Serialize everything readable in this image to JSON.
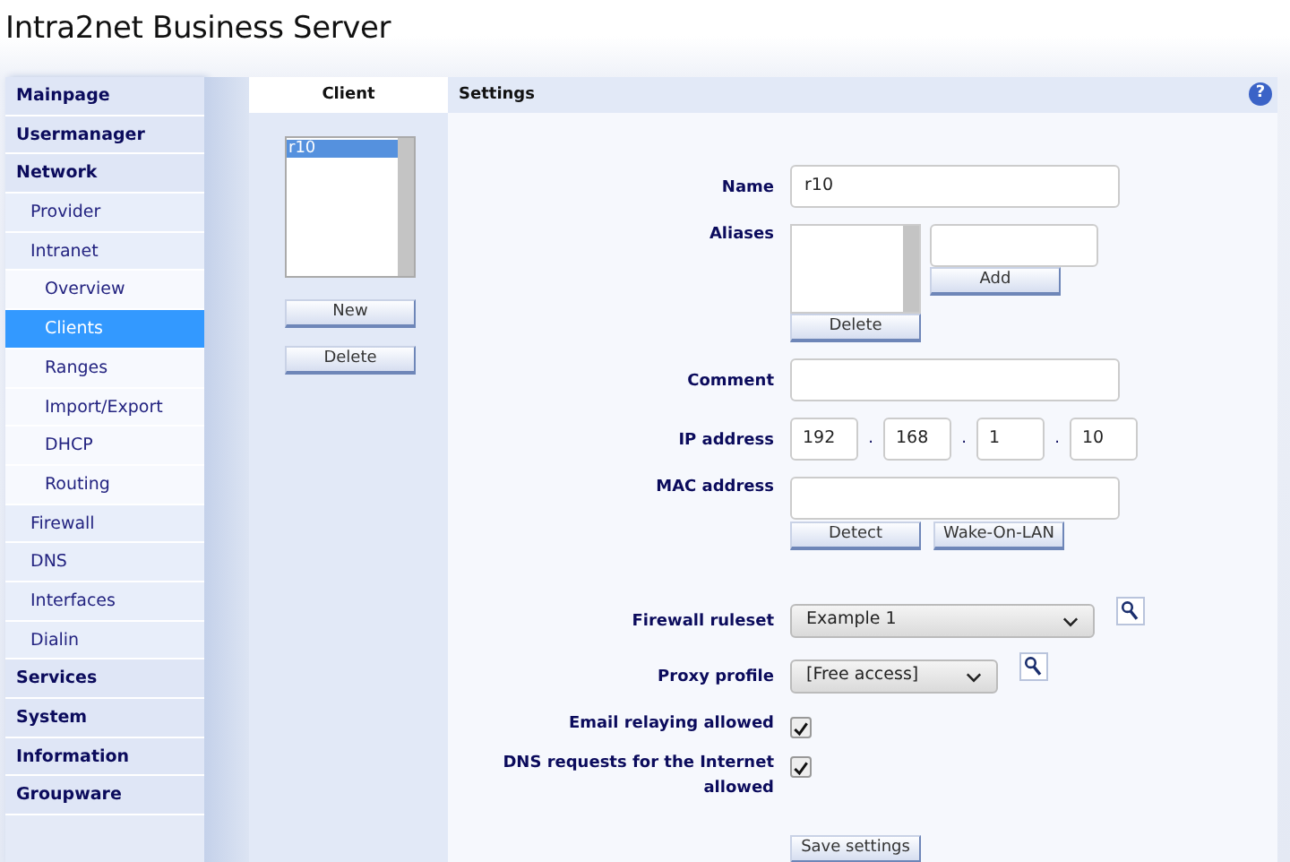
{
  "header": {
    "title": "Intra2net Business Server"
  },
  "sidebar": {
    "items": [
      {
        "label": "Mainpage",
        "selected": false
      },
      {
        "label": "Usermanager",
        "selected": false
      },
      {
        "label": "Network",
        "selected": false,
        "children": [
          {
            "label": "Provider",
            "selected": false
          },
          {
            "label": "Intranet",
            "selected": false,
            "children": [
              {
                "label": "Overview",
                "selected": false
              },
              {
                "label": "Clients",
                "selected": true
              },
              {
                "label": "Ranges",
                "selected": false
              },
              {
                "label": "Import/Export",
                "selected": false
              },
              {
                "label": "DHCP",
                "selected": false
              },
              {
                "label": "Routing",
                "selected": false
              }
            ]
          },
          {
            "label": "Firewall",
            "selected": false
          },
          {
            "label": "DNS",
            "selected": false
          },
          {
            "label": "Interfaces",
            "selected": false
          },
          {
            "label": "Dialin",
            "selected": false
          }
        ]
      },
      {
        "label": "Services",
        "selected": false
      },
      {
        "label": "System",
        "selected": false
      },
      {
        "label": "Information",
        "selected": false
      },
      {
        "label": "Groupware",
        "selected": false
      }
    ]
  },
  "client_panel": {
    "title": "Client",
    "items": [
      {
        "label": "r10",
        "selected": true
      }
    ],
    "buttons": [
      "New",
      "Delete"
    ]
  },
  "settings": {
    "title": "Settings",
    "help": "?",
    "rows": [
      {
        "kind": "text",
        "label": "Name",
        "value": "r10"
      },
      {
        "kind": "aliases",
        "label": "Aliases",
        "list_button": "Delete",
        "add_button": "Add"
      },
      {
        "kind": "text",
        "label": "Comment"
      },
      {
        "kind": "ip",
        "label": "IP address",
        "octets": [
          "192",
          "168",
          "1",
          "10"
        ],
        "separator": "."
      },
      {
        "kind": "mac",
        "label": "MAC address",
        "buttons": [
          "Detect",
          "Wake-On-LAN"
        ]
      },
      {
        "kind": "select",
        "label": "Firewall ruleset",
        "value": "Example 1",
        "wide": true
      },
      {
        "kind": "select",
        "label": "Proxy profile",
        "value": "[Free access]",
        "wide": false
      },
      {
        "kind": "check",
        "label": "Email relaying allowed",
        "checked": true
      },
      {
        "kind": "check",
        "label": "DNS requests for the Internet allowed",
        "checked": true
      }
    ],
    "save_button": "Save settings"
  }
}
